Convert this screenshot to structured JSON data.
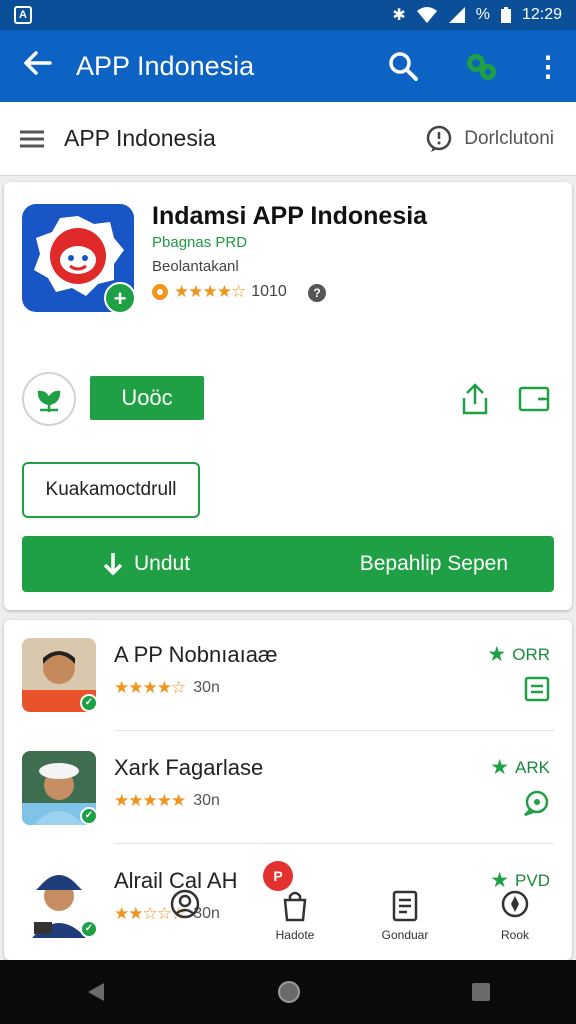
{
  "status_bar": {
    "time": "12:29",
    "battery_text": "%",
    "left_icon": "A"
  },
  "app_bar": {
    "title": "APP Indonesia",
    "back_icon": "back-arrow-icon",
    "search_icon": "search-icon",
    "settings_icon": "gear-icon",
    "more_icon": "more-vert-icon"
  },
  "sub_bar": {
    "title": "APP Indonesia",
    "download_label": "Dorlclutoni"
  },
  "app": {
    "name": "Indamsi APP Indonesia",
    "developer": "Pbagnas PRD",
    "category": "Beolantakanl",
    "rating_stars": 4.5,
    "rating_count": "1010",
    "open_label": "Uoöc",
    "outline_label": "Kuakamoctdrull",
    "download_left": "Undut",
    "download_right": "Bepahlip Sepen"
  },
  "list": [
    {
      "name": "A PP Nobnıaıaæ",
      "rating_stars": 3.5,
      "count": "30n",
      "badge": "ORR",
      "right_icon": "list-icon"
    },
    {
      "name": "Xark Fagarlase",
      "rating_stars": 4.5,
      "count": "30n",
      "badge": "ARK",
      "right_icon": "chat-icon"
    },
    {
      "name": "Alrail Cal AH",
      "rating_stars": 2,
      "count": "30n",
      "badge": "PVD",
      "right_icon": ""
    }
  ],
  "bottom_tabs": [
    {
      "label": "",
      "icon": "person-icon"
    },
    {
      "label": "Hadote",
      "icon": "shopping-bag-icon"
    },
    {
      "label": "Gonduar",
      "icon": "document-icon"
    },
    {
      "label": "Rook",
      "icon": "compass-icon"
    }
  ],
  "pin_badge": "P",
  "colors": {
    "primary": "#0c63c3",
    "accent_green": "#1fa044",
    "star_orange": "#f0941c"
  }
}
